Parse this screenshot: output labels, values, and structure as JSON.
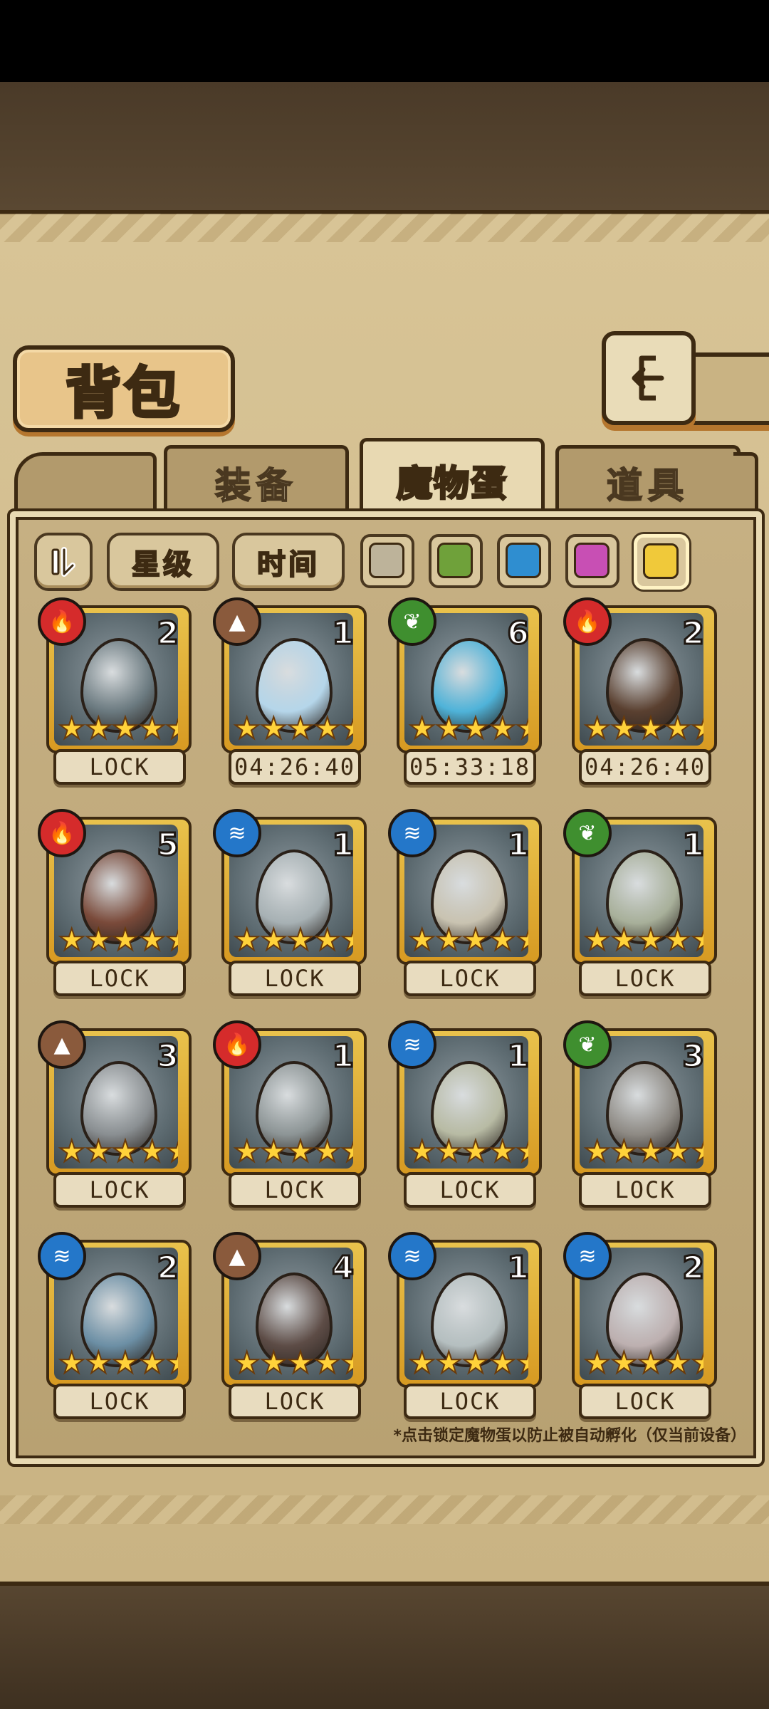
{
  "header": {
    "title": "背包"
  },
  "tabs": [
    {
      "label": "装备"
    },
    {
      "label": "魔物蛋"
    },
    {
      "label": "道具"
    }
  ],
  "filters": {
    "sort_label": "星级",
    "time_label": "时间",
    "colors": [
      "#bdb39a",
      "#6fa13a",
      "#2f8ed0",
      "#c84fb4",
      "#f0c93a"
    ],
    "selected_color_index": 4
  },
  "eggs": [
    {
      "element": "fire",
      "count": "2",
      "status": "LOCK",
      "stars": 5,
      "tint": "#6b7a80"
    },
    {
      "element": "earth",
      "count": "1",
      "status": "04:26:40",
      "stars": 5,
      "tint": "#b5d6ea"
    },
    {
      "element": "nature",
      "count": "6",
      "status": "05:33:18",
      "stars": 5,
      "tint": "#4fb3d9"
    },
    {
      "element": "fire",
      "count": "2",
      "status": "04:26:40",
      "stars": 5,
      "tint": "#5a4030"
    },
    {
      "element": "fire",
      "count": "5",
      "status": "LOCK",
      "stars": 5,
      "tint": "#7a4a3a"
    },
    {
      "element": "water",
      "count": "1",
      "status": "LOCK",
      "stars": 5,
      "tint": "#a7b1b4"
    },
    {
      "element": "water",
      "count": "1",
      "status": "LOCK",
      "stars": 5,
      "tint": "#c9c3b1"
    },
    {
      "element": "nature",
      "count": "1",
      "status": "LOCK",
      "stars": 5,
      "tint": "#a8b09a"
    },
    {
      "element": "earth",
      "count": "3",
      "status": "LOCK",
      "stars": 5,
      "tint": "#8a8f92"
    },
    {
      "element": "fire",
      "count": "1",
      "status": "LOCK",
      "stars": 5,
      "tint": "#8d9596"
    },
    {
      "element": "water",
      "count": "1",
      "status": "LOCK",
      "stars": 5,
      "tint": "#b8bba4"
    },
    {
      "element": "nature",
      "count": "3",
      "status": "LOCK",
      "stars": 5,
      "tint": "#8e8a84"
    },
    {
      "element": "water",
      "count": "2",
      "status": "LOCK",
      "stars": 5,
      "tint": "#6c8fa5"
    },
    {
      "element": "earth",
      "count": "4",
      "status": "LOCK",
      "stars": 5,
      "tint": "#5d4c46"
    },
    {
      "element": "water",
      "count": "1",
      "status": "LOCK",
      "stars": 5,
      "tint": "#b5bfc0"
    },
    {
      "element": "water",
      "count": "2",
      "status": "LOCK",
      "stars": 5,
      "tint": "#bdb0b0"
    }
  ],
  "element_colors": {
    "fire": "#d52b2b",
    "earth": "#8a5a3c",
    "nature": "#3f8f2f",
    "water": "#2477c9"
  },
  "element_icons": {
    "fire": "🔥",
    "earth": "▲",
    "nature": "❦",
    "water": "≋"
  },
  "footnote": "*点击锁定魔物蛋以防止被自动孵化（仅当前设备）"
}
